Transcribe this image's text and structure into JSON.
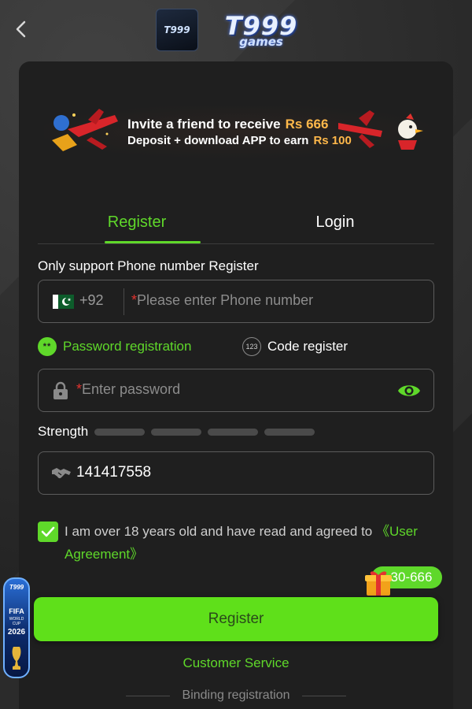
{
  "header": {
    "logo_small": "T999",
    "logo_main": "T999",
    "logo_sub": "games"
  },
  "banner": {
    "line1_text": "Invite a friend to receive",
    "line1_amount": "Rs 666",
    "line2_text": "Deposit + download APP to earn",
    "line2_amount": "Rs 100"
  },
  "tabs": [
    {
      "label": "Register",
      "active": true
    },
    {
      "label": "Login",
      "active": false
    }
  ],
  "form": {
    "hint": "Only support Phone number Register",
    "phone": {
      "country_code": "+92",
      "placeholder": "Please enter Phone number",
      "required_mark": "*"
    },
    "modes": {
      "password_label": "Password registration",
      "password_icon_text": "**",
      "code_label": "Code register",
      "code_icon_text": "123"
    },
    "password": {
      "placeholder": "Enter password",
      "required_mark": "*"
    },
    "strength_label": "Strength",
    "referral_value": "141417558",
    "agreement": {
      "text": "I am over 18 years old and have read and agreed to ",
      "link": "《User Agreement》",
      "checked": true
    }
  },
  "promo_badge": "30-666",
  "register_button": "Register",
  "customer_service": "Customer Service",
  "binding_registration": "Binding registration",
  "side_widget": {
    "logo": "T999",
    "fifa": "FIFA",
    "cup": "WORLD CUP",
    "year": "2026"
  },
  "colors": {
    "accent": "#5fd82a",
    "button": "#5fe01a",
    "background": "#2b2b2b",
    "card": "#1f1f1f",
    "required": "#e2332f",
    "gold": "#ffb84a"
  }
}
